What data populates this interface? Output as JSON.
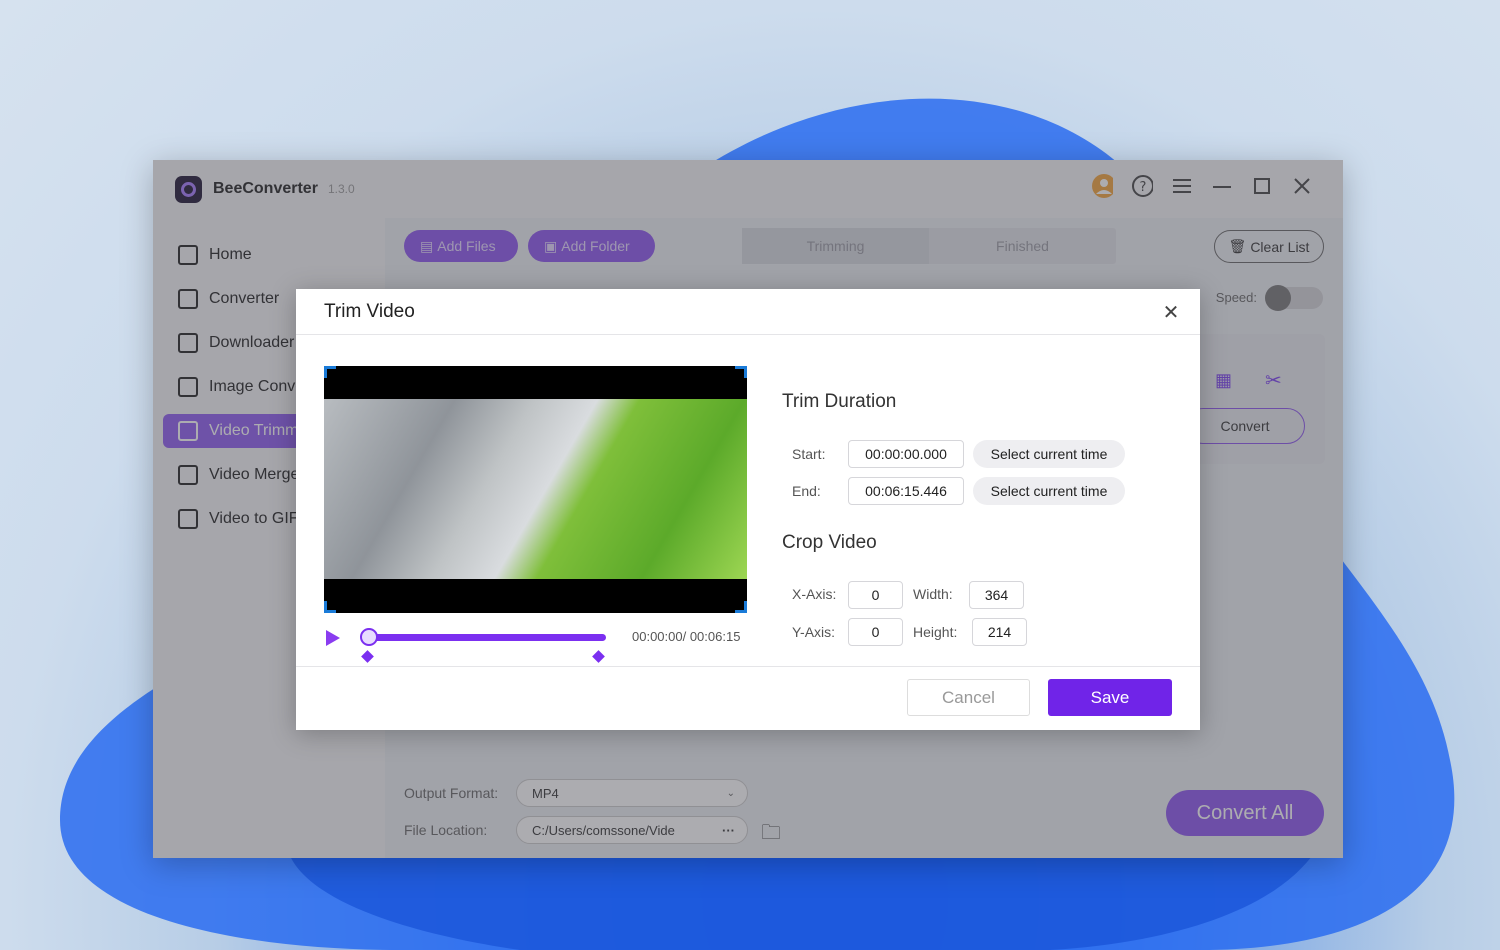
{
  "app": {
    "name": "BeeConverter",
    "version": "1.3.0"
  },
  "sidebar": {
    "items": [
      {
        "label": "Home"
      },
      {
        "label": "Converter"
      },
      {
        "label": "Downloader"
      },
      {
        "label": "Image Converter"
      },
      {
        "label": "Video Trimmer"
      },
      {
        "label": "Video Merger"
      },
      {
        "label": "Video to GIF"
      }
    ]
  },
  "toolbar": {
    "add_files": "Add Files",
    "add_folder": "Add Folder",
    "clear_list": "Clear List"
  },
  "tabs": [
    {
      "label": "Trimming"
    },
    {
      "label": "Finished"
    }
  ],
  "speed_label": "Speed:",
  "item": {
    "convert": "Convert"
  },
  "bottom": {
    "output_format_label": "Output Format:",
    "output_format_value": "MP4",
    "file_location_label": "File Location:",
    "file_location_value": "C:/Users/comssone/Vide",
    "more": "···",
    "convert_all": "Convert All"
  },
  "dialog": {
    "title": "Trim Video",
    "timecode": "00:00:00/ 00:06:15",
    "trim_title": "Trim Duration",
    "start_label": "Start:",
    "start_value": "00:00:00.000",
    "end_label": "End:",
    "end_value": "00:06:15.446",
    "select_current": "Select current time",
    "crop_title": "Crop Video",
    "x_label": "X-Axis:",
    "x_value": "0",
    "y_label": "Y-Axis:",
    "y_value": "0",
    "width_label": "Width:",
    "width_value": "364",
    "height_label": "Height:",
    "height_value": "214",
    "cancel": "Cancel",
    "save": "Save"
  },
  "colors": {
    "accent": "#7024e8",
    "accent_light": "#8c55ee"
  }
}
